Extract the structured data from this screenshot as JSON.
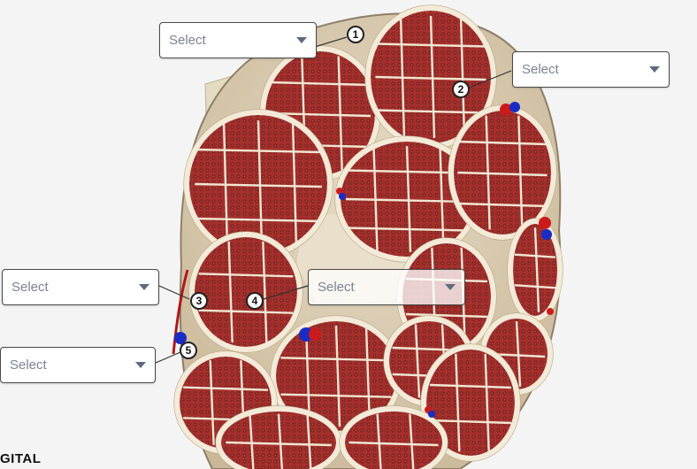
{
  "dropdowns": [
    {
      "id": "1",
      "placeholder": "Select"
    },
    {
      "id": "2",
      "placeholder": "Select"
    },
    {
      "id": "3",
      "placeholder": "Select"
    },
    {
      "id": "4",
      "placeholder": "Select"
    },
    {
      "id": "5",
      "placeholder": "Select"
    }
  ],
  "markers": [
    "1",
    "2",
    "3",
    "4",
    "5"
  ],
  "caption": "GITAL",
  "colors": {
    "fascicle_fill": "#9a2c2a",
    "perineurium": "#f1e8d6",
    "epineurium": "#ddd0b8",
    "artery": "#cc1a1a",
    "vein": "#1a2cc4"
  },
  "icons": {
    "dropdown": "caret-down-icon"
  }
}
